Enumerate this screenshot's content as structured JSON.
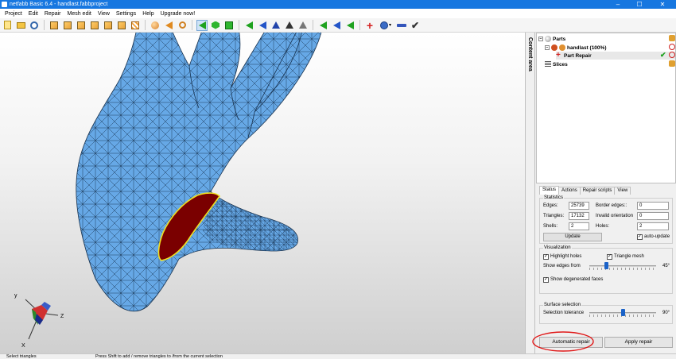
{
  "window": {
    "title": "netfabb Basic 6.4 - handlast.fabbproject",
    "controls": [
      "–",
      "☐",
      "✕"
    ]
  },
  "menu": [
    "Project",
    "Edit",
    "Repair",
    "Mesh edit",
    "View",
    "Settings",
    "Help",
    "Upgrade now!"
  ],
  "toolbar": {
    "icons": [
      "new-project-icon",
      "open-icon",
      "recent-icon",
      "view-front-icon",
      "view-back-icon",
      "view-left-icon",
      "view-right-icon",
      "view-top-icon",
      "view-bottom-icon",
      "pattern-icon",
      "sphere-icon",
      "select-icon",
      "zoom-icon",
      "select-triangles-icon",
      "select-shells-icon",
      "select-surfaces-icon",
      "triangles-tool-icon",
      "holes-tool-icon",
      "repair-tool-icon",
      "cut-tool-icon",
      "measure-icon",
      "triangle-green-icon",
      "triangle-blue-icon",
      "triangle-green-2-icon",
      "add-part-icon",
      "zoom-dropdown-icon",
      "remove-part-icon",
      "check-icon"
    ]
  },
  "content_area_label": "Content area",
  "tree": {
    "parts": "Parts",
    "part_name": "handlast (100%)",
    "part_repair": "Part Repair",
    "slices": "Slices"
  },
  "tabs": [
    "Status",
    "Actions",
    "Repair scripts",
    "View"
  ],
  "statistics": {
    "title": "Statistics",
    "edges_label": "Edges:",
    "edges": "25739",
    "triangles_label": "Triangles:",
    "triangles": "17132",
    "shells_label": "Shells:",
    "shells": "2",
    "border_edges_label": "Border edges::",
    "border_edges": "0",
    "invalid_orientation_label": "Invalid orientation",
    "invalid_orientation": "0",
    "holes_label": "Holes:",
    "holes": "2",
    "update_label": "Update",
    "auto_update_label": "auto-update",
    "auto_update_checked": true
  },
  "visualization": {
    "title": "Visualization",
    "highlight_holes_label": "Highlight holes",
    "highlight_holes_checked": true,
    "triangle_mesh_label": "Triangle mesh",
    "triangle_mesh_checked": true,
    "show_edges_label": "Show edges from",
    "show_edges_value": "45°",
    "show_edges_fraction": 0.25,
    "show_degenerated_label": "Show degenerated faces",
    "show_degenerated_checked": true
  },
  "surface_selection": {
    "title": "Surface selection",
    "tolerance_label": "Selection tolerance",
    "tolerance_value": "90°",
    "tolerance_fraction": 0.5
  },
  "buttons": {
    "automatic_repair": "Automatic repair",
    "apply_repair": "Apply repair"
  },
  "axes": {
    "y": "y",
    "z": "Z",
    "x": "X"
  },
  "status": {
    "left": "Select triangles",
    "middle": "Press Shift to add / remove triangles to /from the current selection"
  },
  "colors": {
    "mesh_fill": "#66a8e6",
    "mesh_line": "#16304d",
    "hole_fill": "#7a0000",
    "hole_border": "#f0e020",
    "annotation": "#e01818",
    "titlebar": "#1777e0"
  }
}
